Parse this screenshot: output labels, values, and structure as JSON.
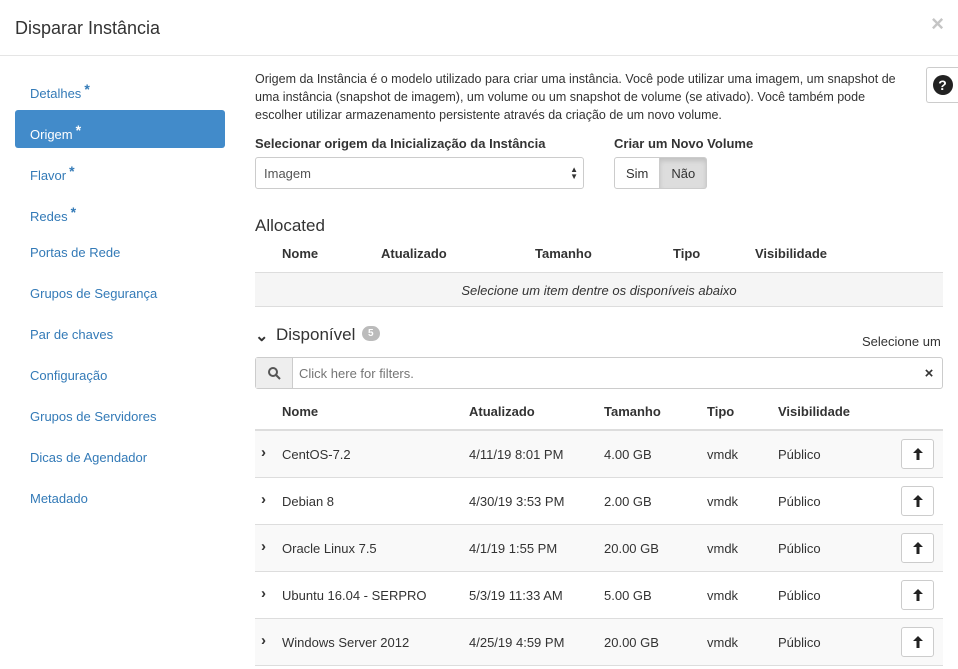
{
  "modal": {
    "title": "Disparar Instância",
    "close": "×"
  },
  "sidebar": {
    "items": [
      {
        "label": "Detalhes",
        "required": "*"
      },
      {
        "label": "Origem",
        "required": "*"
      },
      {
        "label": "Flavor",
        "required": "*"
      },
      {
        "label": "Redes",
        "required": "*"
      },
      {
        "label": "Portas de Rede",
        "required": ""
      },
      {
        "label": "Grupos de Segurança",
        "required": ""
      },
      {
        "label": "Par de chaves",
        "required": ""
      },
      {
        "label": "Configuração",
        "required": ""
      },
      {
        "label": "Grupos de Servidores",
        "required": ""
      },
      {
        "label": "Dicas de Agendador",
        "required": ""
      },
      {
        "label": "Metadado",
        "required": ""
      }
    ]
  },
  "source": {
    "description": "Origem da Instância é o modelo utilizado para criar uma instância. Você pode utilizar uma imagem, um snapshot de uma instância (snapshot de imagem), um volume ou um snapshot de volume (se ativado). Você também pode escolher utilizar armazenamento persistente através da criação de um novo volume.",
    "help": "?",
    "boot_source_label": "Selecionar origem da Inicialização da Instância",
    "boot_source_value": "Imagem",
    "new_volume_label": "Criar um Novo Volume",
    "yes": "Sim",
    "no": "Não"
  },
  "allocated": {
    "title": "Allocated",
    "headers": [
      "Nome",
      "Atualizado",
      "Tamanho",
      "Tipo",
      "Visibilidade"
    ],
    "empty": "Selecione um item dentre os disponíveis abaixo"
  },
  "available": {
    "title": "Disponível",
    "count": "5",
    "select_one": "Selecione um",
    "filter_placeholder": "Click here for filters.",
    "headers": [
      "Nome",
      "Atualizado",
      "Tamanho",
      "Tipo",
      "Visibilidade"
    ],
    "rows": [
      {
        "name": "CentOS-7.2",
        "updated": "4/11/19 8:01 PM",
        "size": "4.00 GB",
        "type": "vmdk",
        "visibility": "Público"
      },
      {
        "name": "Debian 8",
        "updated": "4/30/19 3:53 PM",
        "size": "2.00 GB",
        "type": "vmdk",
        "visibility": "Público"
      },
      {
        "name": "Oracle Linux 7.5",
        "updated": "4/1/19 1:55 PM",
        "size": "20.00 GB",
        "type": "vmdk",
        "visibility": "Público"
      },
      {
        "name": "Ubuntu 16.04 - SERPRO",
        "updated": "5/3/19 11:33 AM",
        "size": "5.00 GB",
        "type": "vmdk",
        "visibility": "Público"
      },
      {
        "name": "Windows Server 2012",
        "updated": "4/25/19 4:59 PM",
        "size": "20.00 GB",
        "type": "vmdk",
        "visibility": "Público"
      }
    ]
  },
  "colors": {
    "accent": "#428bca",
    "link": "#337ab7"
  }
}
